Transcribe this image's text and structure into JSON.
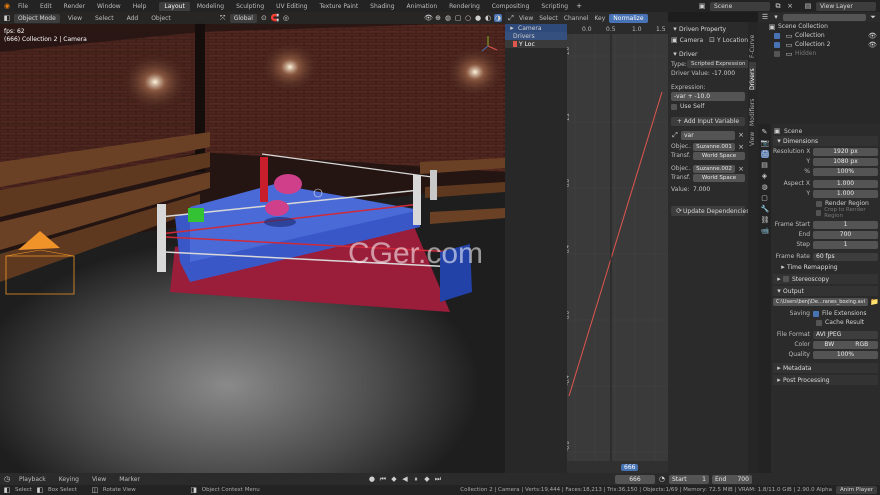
{
  "topbar": {
    "menus": [
      "File",
      "Edit",
      "Render",
      "Window",
      "Help"
    ],
    "workspaces": [
      "Layout",
      "Modeling",
      "Sculpting",
      "UV Editing",
      "Texture Paint",
      "Shading",
      "Animation",
      "Rendering",
      "Compositing",
      "Scripting"
    ],
    "active_workspace": "Layout",
    "scene": "Scene",
    "view_layer": "View Layer"
  },
  "viewport": {
    "mode": "Object Mode",
    "menus": [
      "View",
      "Select",
      "Add",
      "Object"
    ],
    "transform": "Global",
    "fps": "fps: 62",
    "info": "(666) Collection 2 | Camera",
    "watermark": "CGer.com"
  },
  "driver_editor": {
    "menus": [
      "View",
      "Select",
      "Channel",
      "Key"
    ],
    "normalize": "Normalize",
    "channels": [
      "Camera",
      "Drivers",
      "Y Loc"
    ],
    "ruler": [
      "0.0",
      "0.5",
      "1.0",
      "1.5"
    ],
    "yticks": [
      "1.6",
      "1.2",
      "0.8",
      "0.4",
      "0.0",
      "-0.4",
      "-0.8"
    ],
    "frame": "666"
  },
  "driver_panel": {
    "tabs": [
      "F-Curve",
      "Modifiers",
      "Drivers",
      "View"
    ],
    "driven_property_title": "Driven Property",
    "object": "Camera",
    "property": "Y Location",
    "driver_title": "Driver",
    "type_label": "Type:",
    "type_value": "Scripted Expression",
    "driver_value_label": "Driver Value:",
    "driver_value": "-17.000",
    "expression_label": "Expression:",
    "expression": "-var + -10.0",
    "use_self": "Use Self",
    "add_variable": "Add Input Variable",
    "var_name": "var",
    "object_label": "Objec...",
    "object_1": "Suzanne.001",
    "transform_label": "Transf...",
    "space": "World Space",
    "object_2": "Suzanne.002",
    "value_label": "Value:",
    "value": "7.000",
    "update_deps": "Update Dependencies"
  },
  "outliner": {
    "items": [
      "Scene Collection",
      "Collection",
      "Collection 2",
      "Hidden"
    ]
  },
  "properties": {
    "scene": "Scene",
    "dimensions": "Dimensions",
    "res_x_label": "Resolution X",
    "res_x": "1920 px",
    "res_y_label": "Y",
    "res_y": "1080 px",
    "pct_label": "%",
    "pct": "100%",
    "aspect_x_label": "Aspect X",
    "aspect_x": "1.000",
    "aspect_y_label": "Y",
    "aspect_y": "1.000",
    "render_region": "Render Region",
    "crop_region": "Crop to Render Region",
    "frame_start_label": "Frame Start",
    "frame_start": "1",
    "end_label": "End",
    "end": "700",
    "step_label": "Step",
    "step": "1",
    "frame_rate_label": "Frame Rate",
    "frame_rate": "60 fps",
    "time_remapping": "Time Remapping",
    "stereoscopy": "Stereoscopy",
    "output": "Output",
    "output_path": "C:\\Users\\benj\\De...ranes_boxing.avi",
    "saving_label": "Saving",
    "file_extensions": "File Extensions",
    "cache_result": "Cache Result",
    "file_format_label": "File Format",
    "file_format": "AVI JPEG",
    "color_label": "Color",
    "color_bw": "BW",
    "color_rgb": "RGB",
    "quality_label": "Quality",
    "quality": "100%",
    "metadata": "Metadata",
    "post_processing": "Post Processing"
  },
  "timeline": {
    "menus": [
      "Playback",
      "Keying",
      "View",
      "Marker"
    ],
    "current": "666",
    "start_label": "Start",
    "start": "1",
    "end_label": "End",
    "end": "700"
  },
  "statusbar": {
    "select": "Select",
    "box_select": "Box Select",
    "rotate": "Rotate View",
    "context": "Object Context Menu",
    "stats": "Collection 2 | Camera | Verts:19,444 | Faces:18,213 | Tris:36,150 | Objects:1/69 | Memory: 72.5 MiB | VRAM: 1.8/11.0 GiB | 2.90.0 Alpha",
    "anim_player": "Anim Player"
  },
  "colors": {
    "accent": "#4772b3",
    "curve": "#e0554e",
    "playhead": "#4772b3"
  }
}
